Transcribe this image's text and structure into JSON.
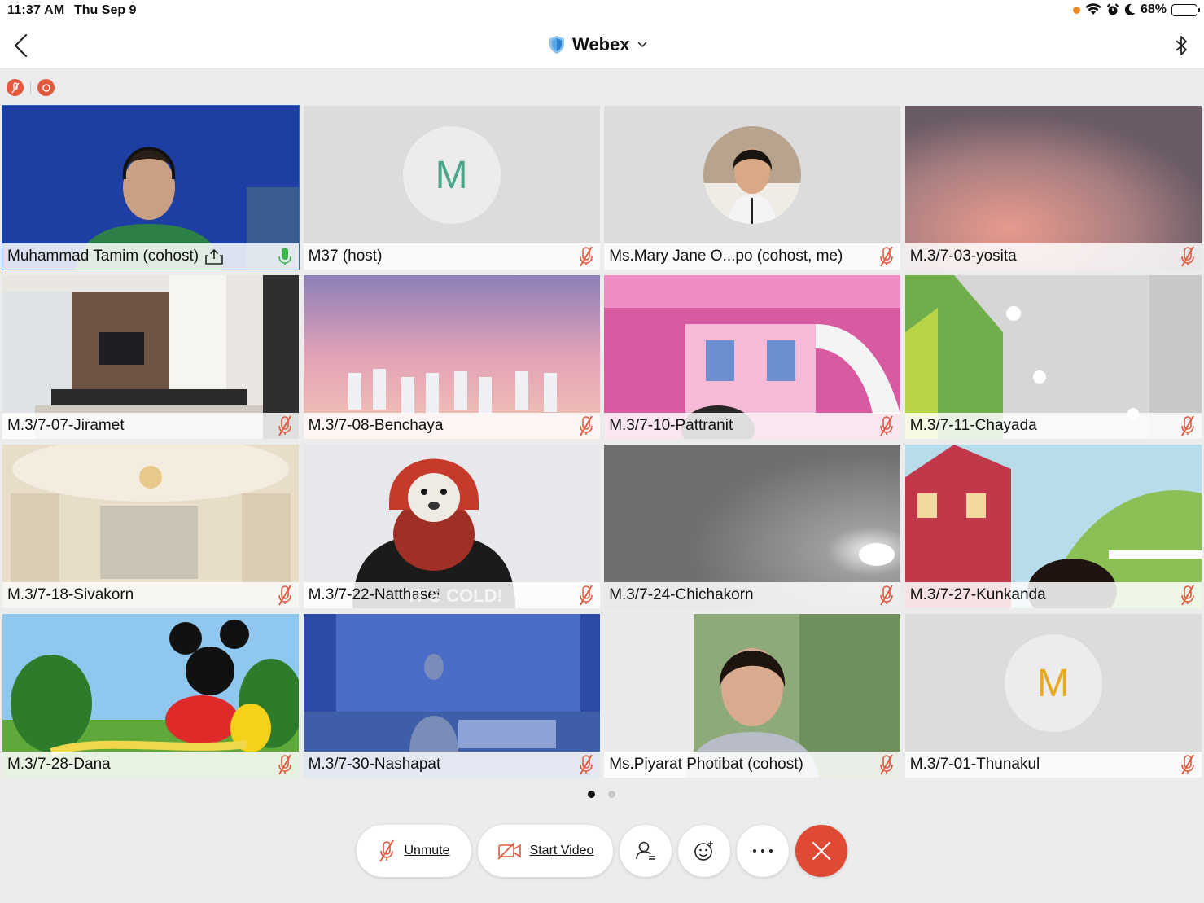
{
  "status_bar": {
    "time": "11:37 AM",
    "date": "Thu Sep 9",
    "battery": "68%",
    "battery_level": 0.68
  },
  "nav": {
    "title": "Webex",
    "back_icon": "chevron-left-icon",
    "bluetooth_icon": "bluetooth-icon"
  },
  "colors": {
    "accent": "#2b6fc5",
    "mute_red": "#e4583e",
    "end_red": "#de4a34",
    "avatar_teal": "#4aa58a",
    "avatar_orange": "#e8a820",
    "speaking_green": "#3bb54a"
  },
  "participants": [
    {
      "name": "Muhammad Tamim (cohost)",
      "active": true,
      "sharing": true,
      "mic": "speaking"
    },
    {
      "name": "M37 (host)",
      "avatar": "M",
      "mic": "muted"
    },
    {
      "name": "Ms.Mary Jane O...po (cohost, me)",
      "mic": "muted"
    },
    {
      "name": "M.3/7-03-yosita",
      "mic": "muted"
    },
    {
      "name": "M.3/7-07-Jiramet",
      "mic": "muted"
    },
    {
      "name": "M.3/7-08-Benchaya",
      "mic": "muted"
    },
    {
      "name": "M.3/7-10-Pattranit",
      "mic": "muted"
    },
    {
      "name": "M.3/7-11-Chayada",
      "mic": "muted"
    },
    {
      "name": "M.3/7-18-Sivakorn",
      "mic": "muted"
    },
    {
      "name": "M.3/7-22-Natthaset",
      "mic": "muted",
      "overlay_text": "IT'S COLD!"
    },
    {
      "name": "M.3/7-24-Chichakorn",
      "mic": "muted"
    },
    {
      "name": "M.3/7-27-Kunkanda",
      "mic": "muted"
    },
    {
      "name": "M.3/7-28-Dana",
      "mic": "muted"
    },
    {
      "name": "M.3/7-30-Nashapat",
      "mic": "muted"
    },
    {
      "name": "Ms.Piyarat Photibat (cohost)",
      "mic": "muted"
    },
    {
      "name": "M.3/7-01-Thunakul",
      "avatar": "M",
      "mic": "muted"
    }
  ],
  "pagination": {
    "current": 1,
    "total": 2
  },
  "toolbar": {
    "unmute_label": "Unmute",
    "start_video_label": "Start Video"
  }
}
